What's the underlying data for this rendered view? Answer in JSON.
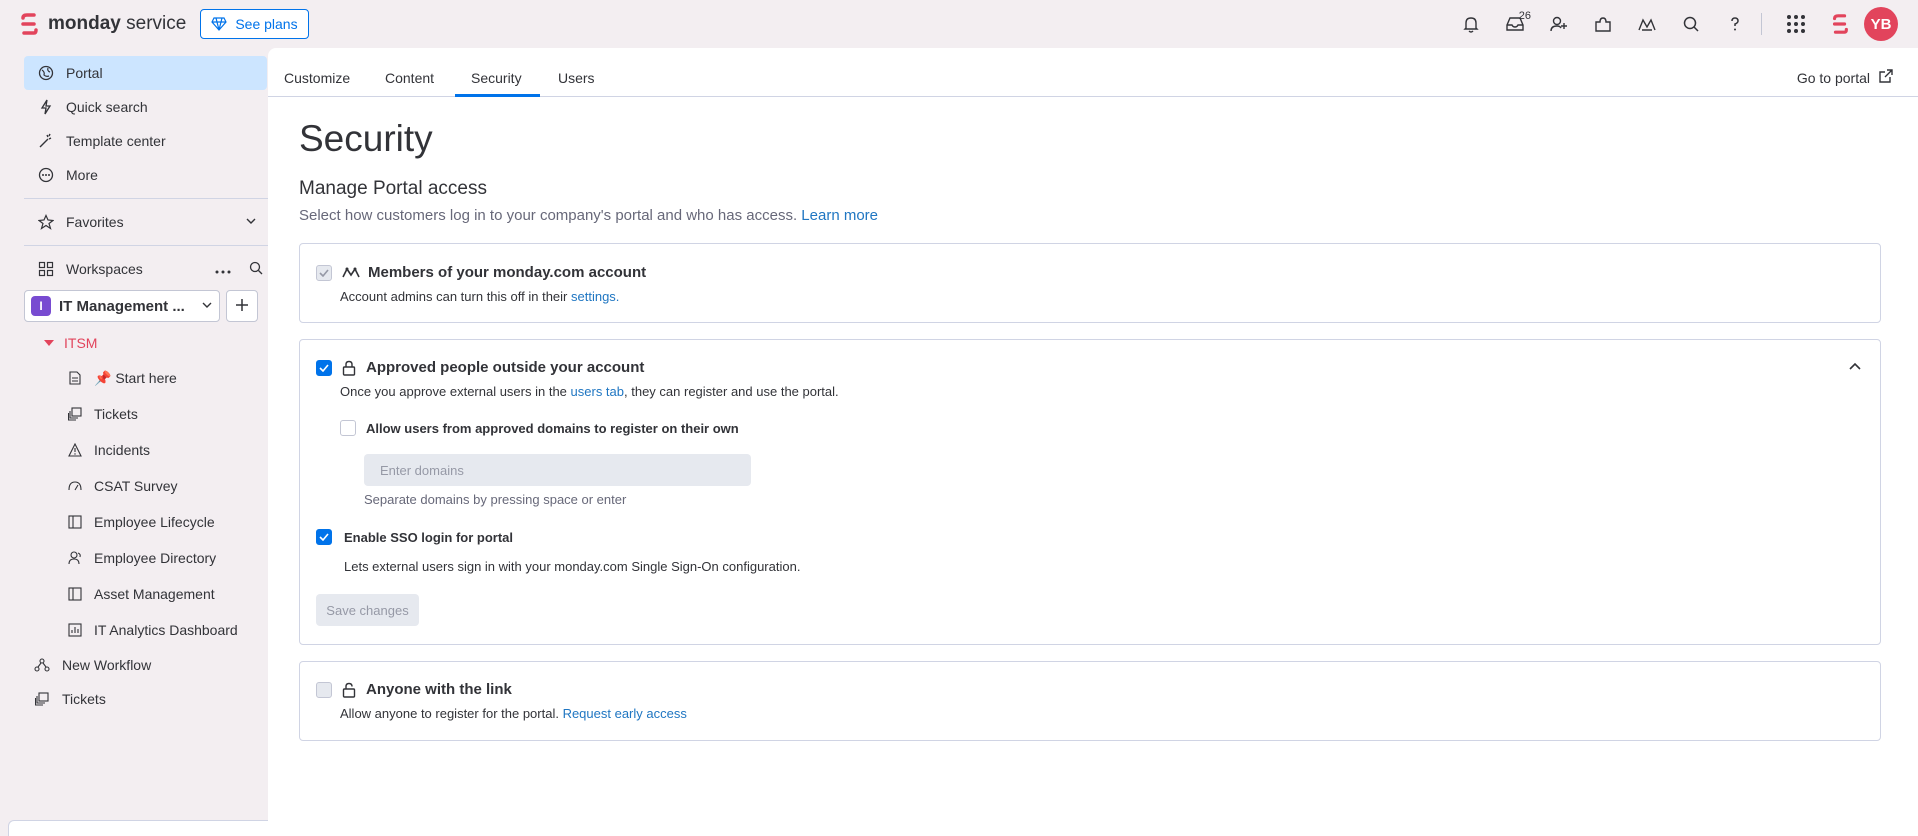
{
  "app": {
    "brand_bold": "monday",
    "brand_light": " service",
    "see_plans": "See plans",
    "inbox_count": "26",
    "avatar_initials": "YB"
  },
  "sidebar": {
    "items": [
      {
        "label": "Portal",
        "icon": "portal-icon"
      },
      {
        "label": "Quick search",
        "icon": "lightning-icon"
      },
      {
        "label": "Template center",
        "icon": "wand-icon"
      },
      {
        "label": "More",
        "icon": "more-circle-icon"
      }
    ],
    "favorites": "Favorites",
    "workspaces": "Workspaces",
    "workspace_letter": "I",
    "workspace_name": "IT Management ...",
    "folder": "ITSM",
    "folder_items": [
      {
        "label": "📌 Start here",
        "icon": "doc-icon"
      },
      {
        "label": "Tickets",
        "icon": "tickets-icon"
      },
      {
        "label": "Incidents",
        "icon": "warning-icon"
      },
      {
        "label": "CSAT Survey",
        "icon": "gauge-icon"
      },
      {
        "label": "Employee Lifecycle",
        "icon": "board-icon"
      },
      {
        "label": "Employee Directory",
        "icon": "people-icon"
      },
      {
        "label": "Asset Management",
        "icon": "board-icon"
      },
      {
        "label": "IT Analytics Dashboard",
        "icon": "dashboard-icon"
      }
    ],
    "extra_items": [
      {
        "label": "New Workflow",
        "icon": "workflow-icon"
      },
      {
        "label": "Tickets",
        "icon": "tickets-icon"
      }
    ]
  },
  "tabs": [
    "Customize",
    "Content",
    "Security",
    "Users"
  ],
  "goto_portal": "Go to portal",
  "page": {
    "title": "Security",
    "section_title": "Manage Portal access",
    "section_desc": "Select how customers log in to your company's portal and who has access.",
    "learn_more": "Learn more"
  },
  "cards": {
    "members": {
      "title": "Members of your monday.com account",
      "desc": "Account admins can turn this off in their ",
      "desc_link": "settings."
    },
    "approved": {
      "title": "Approved people outside your account",
      "desc_pre": "Once you approve external users in the ",
      "desc_link": "users tab",
      "desc_post": ", they can register and use the portal.",
      "allow_domains": "Allow users from approved domains to register on their own",
      "domains_placeholder": "Enter domains",
      "domains_hint": "Separate domains by pressing space or enter",
      "sso_label": "Enable SSO login for portal",
      "sso_desc": "Lets external users sign in with your monday.com Single Sign-On configuration.",
      "save": "Save changes"
    },
    "anyone": {
      "title": "Anyone with the link",
      "desc": "Allow anyone to register for the portal. ",
      "desc_link": "Request early access"
    }
  },
  "colors": {
    "accent": "#0073ea",
    "link": "#1f76c2",
    "folder": "#e2445c",
    "active_nav": "#cce5ff"
  }
}
